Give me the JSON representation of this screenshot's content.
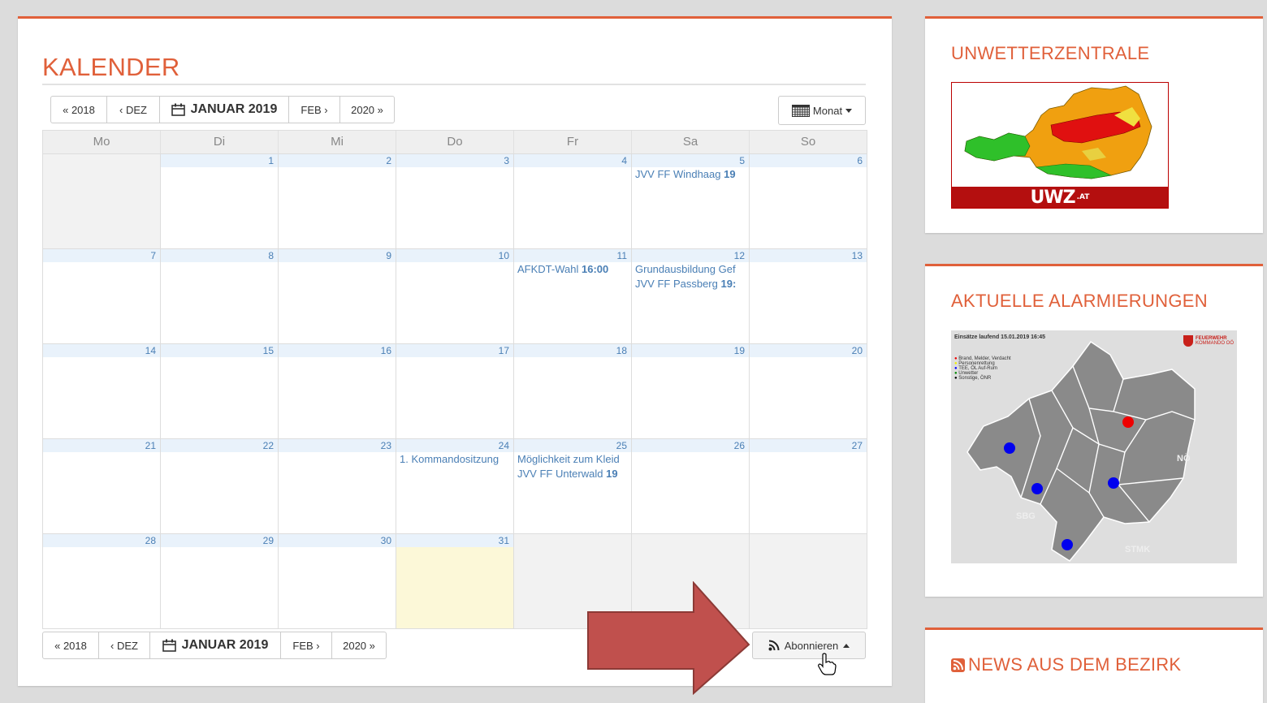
{
  "calendar": {
    "title": "KALENDER",
    "nav": {
      "prev_year": "« 2018",
      "prev_month": "‹ DEZ",
      "current": "JANUAR 2019",
      "next_month": "FEB ›",
      "next_year": "2020 »"
    },
    "view_label": "Monat",
    "subscribe_label": "Abonnieren",
    "weekdays": [
      "Mo",
      "Di",
      "Mi",
      "Do",
      "Fr",
      "Sa",
      "So"
    ],
    "weeks": [
      [
        {
          "num": "",
          "off": true,
          "events": []
        },
        {
          "num": "1",
          "events": []
        },
        {
          "num": "2",
          "events": []
        },
        {
          "num": "3",
          "events": []
        },
        {
          "num": "4",
          "events": []
        },
        {
          "num": "5",
          "events": [
            {
              "title": "JVV FF Windhaag",
              "time": "19"
            }
          ]
        },
        {
          "num": "6",
          "events": []
        }
      ],
      [
        {
          "num": "7",
          "events": []
        },
        {
          "num": "8",
          "events": []
        },
        {
          "num": "9",
          "events": []
        },
        {
          "num": "10",
          "events": []
        },
        {
          "num": "11",
          "events": [
            {
              "title": "AFKDT-Wahl",
              "time": "16:00"
            }
          ]
        },
        {
          "num": "12",
          "events": [
            {
              "title": "Grundausbildung Gef",
              "time": ""
            },
            {
              "title": "JVV FF Passberg",
              "time": "19:"
            }
          ]
        },
        {
          "num": "13",
          "events": []
        }
      ],
      [
        {
          "num": "14",
          "events": []
        },
        {
          "num": "15",
          "events": []
        },
        {
          "num": "16",
          "events": []
        },
        {
          "num": "17",
          "events": []
        },
        {
          "num": "18",
          "events": []
        },
        {
          "num": "19",
          "events": []
        },
        {
          "num": "20",
          "events": []
        }
      ],
      [
        {
          "num": "21",
          "events": []
        },
        {
          "num": "22",
          "events": []
        },
        {
          "num": "23",
          "events": []
        },
        {
          "num": "24",
          "events": [
            {
              "title": "1. Kommandositzung",
              "time": ""
            }
          ]
        },
        {
          "num": "25",
          "events": [
            {
              "title": "Möglichkeit zum Kleid",
              "time": ""
            },
            {
              "title": "JVV FF Unterwald",
              "time": "19"
            }
          ]
        },
        {
          "num": "26",
          "events": []
        },
        {
          "num": "27",
          "events": []
        }
      ],
      [
        {
          "num": "28",
          "events": []
        },
        {
          "num": "29",
          "events": []
        },
        {
          "num": "30",
          "events": []
        },
        {
          "num": "31",
          "today": true,
          "events": []
        },
        {
          "num": "",
          "off": true,
          "events": []
        },
        {
          "num": "",
          "off": true,
          "events": []
        },
        {
          "num": "",
          "off": true,
          "events": []
        }
      ]
    ]
  },
  "sidebar": {
    "uwz_title": "UNWETTERZENTRALE",
    "uwz_logo": "UWZ",
    "uwz_logo_suffix": ".AT",
    "alarm_title": "AKTUELLE ALARMIERUNGEN",
    "alarm_map": {
      "header": "Einsätze laufend 15.01.2019 16:45",
      "legend": [
        "Brand, Melder, Verdacht",
        "Personenrettung",
        "TEE, ÖL Auf-Rum",
        "Unwetter",
        "Sonstige, ÖNR"
      ],
      "logo_text": "FEUERWEHR",
      "logo_sub": "KOMMANDO OÖ",
      "region_labels": [
        "NÖ",
        "SBG",
        "STMK"
      ]
    },
    "news_title": "NEWS AUS DEM BEZIRK"
  },
  "colors": {
    "accent": "#e0603a",
    "link": "#4a7fb5",
    "today": "#fcf8d8",
    "arrow": "#c0504d"
  }
}
